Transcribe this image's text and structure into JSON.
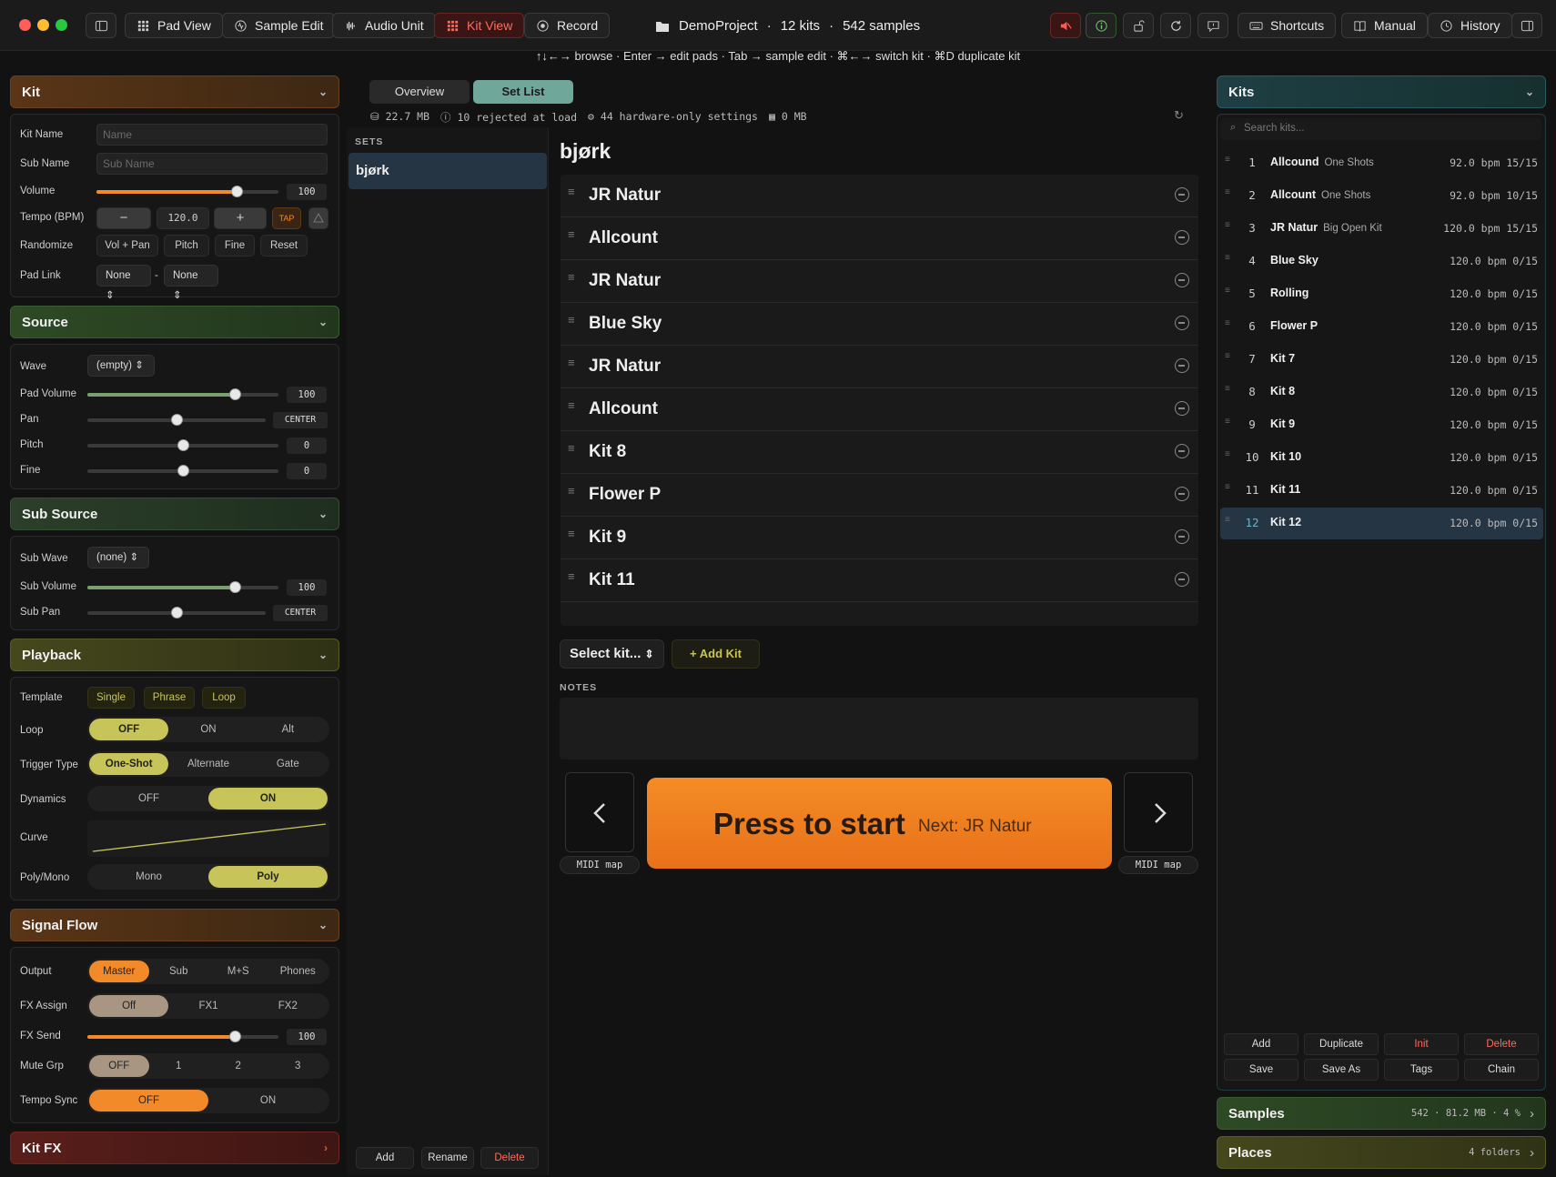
{
  "toolbar": {
    "pad_view": "Pad View",
    "sample_edit": "Sample Edit",
    "audio_unit": "Audio Unit",
    "kit_view": "Kit View",
    "record": "Record",
    "project": "DemoProject",
    "kits": "12 kits",
    "samples": "542 samples",
    "shortcuts": "Shortcuts",
    "manual": "Manual",
    "history": "History",
    "sep": "·"
  },
  "hint": "↑↓←→ browse · Enter → edit pads · Tab → sample edit · ⌘←→ switch kit · ⌘D duplicate kit",
  "kit_panel": {
    "title": "Kit",
    "kit_name_label": "Kit Name",
    "kit_name_placeholder": "Name",
    "sub_name_label": "Sub Name",
    "sub_name_placeholder": "Sub Name",
    "volume_label": "Volume",
    "volume": "100",
    "volume_level": 0.77,
    "tempo_label": "Tempo (BPM)",
    "tempo": "120.0",
    "minus": "−",
    "plus": "+",
    "tap": "TAP",
    "randomize_label": "Randomize",
    "rand": [
      "Vol + Pan",
      "Pitch",
      "Fine",
      "Reset"
    ],
    "padlink_label": "Pad Link",
    "padlink_a": "None",
    "padlink_b": "None",
    "dash": "-"
  },
  "source_panel": {
    "title": "Source",
    "wave_label": "Wave",
    "wave": "(empty)",
    "padvol_label": "Pad Volume",
    "padvol": "100",
    "padvol_level": 0.77,
    "pan_label": "Pan",
    "pan": "CENTER",
    "pan_level": 0.5,
    "pitch_label": "Pitch",
    "pitch": "0",
    "pitch_level": 0.5,
    "fine_label": "Fine",
    "fine": "0",
    "fine_level": 0.5
  },
  "subsource_panel": {
    "title": "Sub Source",
    "subwave_label": "Sub Wave",
    "subwave": "(none)",
    "subvol_label": "Sub Volume",
    "subvol": "100",
    "subvol_level": 0.77,
    "subpan_label": "Sub Pan",
    "subpan": "CENTER",
    "subpan_level": 0.5
  },
  "playback_panel": {
    "title": "Playback",
    "template_label": "Template",
    "templates": [
      "Single",
      "Phrase",
      "Loop"
    ],
    "loop_label": "Loop",
    "loop": [
      "OFF",
      "ON",
      "Alt"
    ],
    "trigger_label": "Trigger Type",
    "trigger": [
      "One-Shot",
      "Alternate",
      "Gate"
    ],
    "dynamics_label": "Dynamics",
    "dynamics": [
      "OFF",
      "ON"
    ],
    "curve_label": "Curve",
    "poly_label": "Poly/Mono",
    "poly": [
      "Mono",
      "Poly"
    ]
  },
  "signal_panel": {
    "title": "Signal Flow",
    "output_label": "Output",
    "output": [
      "Master",
      "Sub",
      "M+S",
      "Phones"
    ],
    "fxassign_label": "FX Assign",
    "fxassign": [
      "Off",
      "FX1",
      "FX2"
    ],
    "fxsend_label": "FX Send",
    "fxsend": "100",
    "fxsend_level": 0.77,
    "mutegrp_label": "Mute Grp",
    "mutegrp": [
      "OFF",
      "1",
      "2",
      "3"
    ],
    "temposync_label": "Tempo Sync",
    "temposync": [
      "OFF",
      "ON"
    ]
  },
  "kitfx_title": "Kit FX",
  "center": {
    "tabs": [
      "Overview",
      "Set List"
    ],
    "stats": [
      "22.7 MB",
      "10 rejected at load",
      "44 hardware-only settings",
      "0 MB"
    ],
    "sets_header": "SETS",
    "sets": [
      "bjørk"
    ],
    "set_title": "bjørk",
    "setlist": [
      "JR Natur",
      "Allcount",
      "JR Natur",
      "Blue Sky",
      "JR Natur",
      "Allcount",
      "Kit 8",
      "Flower P",
      "Kit 9",
      "Kit 11"
    ],
    "select_kit": "Select kit...",
    "add_kit": "Add Kit",
    "notes_label": "NOTES",
    "start_label": "Press to start",
    "next_label": "Next: JR Natur",
    "midi_map": "MIDI map",
    "sets_buttons": [
      "Add",
      "Rename",
      "Delete"
    ]
  },
  "kits_panel": {
    "title": "Kits",
    "search_placeholder": "Search kits...",
    "kits": [
      {
        "n": "1",
        "name": "Allcound",
        "sub": "One Shots",
        "meta": "92.0 bpm 15/15"
      },
      {
        "n": "2",
        "name": "Allcount",
        "sub": "One Shots",
        "meta": "92.0 bpm 10/15"
      },
      {
        "n": "3",
        "name": "JR Natur",
        "sub": "Big Open Kit",
        "meta": "120.0 bpm 15/15"
      },
      {
        "n": "4",
        "name": "Blue Sky",
        "sub": "",
        "meta": "120.0 bpm 0/15"
      },
      {
        "n": "5",
        "name": "Rolling",
        "sub": "",
        "meta": "120.0 bpm 0/15"
      },
      {
        "n": "6",
        "name": "Flower P",
        "sub": "",
        "meta": "120.0 bpm 0/15"
      },
      {
        "n": "7",
        "name": "Kit 7",
        "sub": "",
        "meta": "120.0 bpm 0/15"
      },
      {
        "n": "8",
        "name": "Kit 8",
        "sub": "",
        "meta": "120.0 bpm 0/15"
      },
      {
        "n": "9",
        "name": "Kit 9",
        "sub": "",
        "meta": "120.0 bpm 0/15"
      },
      {
        "n": "10",
        "name": "Kit 10",
        "sub": "",
        "meta": "120.0 bpm 0/15"
      },
      {
        "n": "11",
        "name": "Kit 11",
        "sub": "",
        "meta": "120.0 bpm 0/15"
      },
      {
        "n": "12",
        "name": "Kit 12",
        "sub": "",
        "meta": "120.0 bpm 0/15"
      }
    ],
    "buttons": [
      "Add",
      "Duplicate",
      "Init",
      "Delete",
      "Save",
      "Save As",
      "Tags",
      "Chain"
    ]
  },
  "samples_panel": {
    "title": "Samples",
    "meta": "542 · 81.2 MB · 4 %"
  },
  "places_panel": {
    "title": "Places",
    "meta": "4 folders"
  },
  "colors": {
    "accent_orange": "#f28a2a",
    "accent_olive": "#c7c45a",
    "teal": "#6fa89a"
  }
}
